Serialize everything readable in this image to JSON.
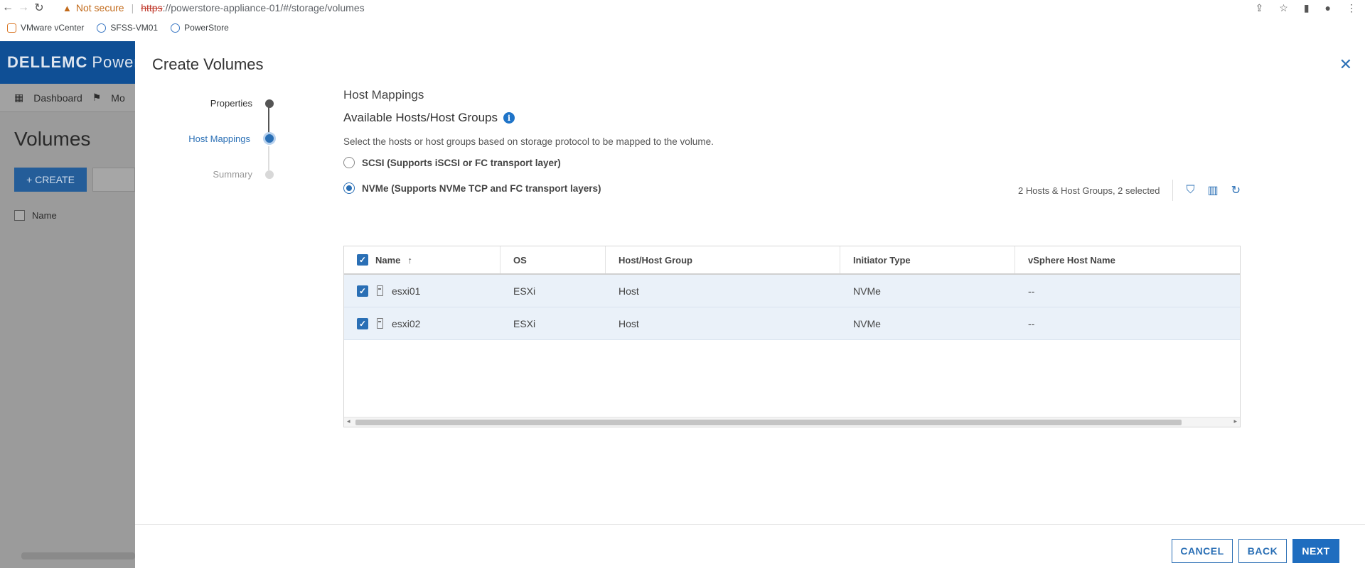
{
  "browser": {
    "warning_text": "Not secure",
    "url_scheme": "https",
    "url_rest": "://powerstore-appliance-01/#/storage/volumes",
    "bookmarks": [
      "VMware vCenter",
      "SFSS-VM01",
      "PowerStore"
    ]
  },
  "background_app": {
    "brand": "DELLEMC",
    "product": "Power",
    "nav_items": [
      "Dashboard",
      "Mo"
    ],
    "page_title": "Volumes",
    "create_label": "+ CREATE",
    "column_name": "Name"
  },
  "dialog": {
    "title": "Create Volumes",
    "steps": [
      {
        "label": "Properties",
        "state": "completed"
      },
      {
        "label": "Host Mappings",
        "state": "current"
      },
      {
        "label": "Summary",
        "state": "pending"
      }
    ],
    "section_title": "Host Mappings",
    "subtitle": "Available Hosts/Host Groups",
    "description": "Select the hosts or host groups based on storage protocol to be mapped to the volume.",
    "protocols": [
      {
        "label": "SCSI (Supports iSCSI or FC transport layer)",
        "selected": false
      },
      {
        "label": "NVMe (Supports NVMe TCP and FC transport layers)",
        "selected": true
      }
    ],
    "table_summary": "2 Hosts & Host Groups, 2 selected",
    "columns": [
      "Name",
      "OS",
      "Host/Host Group",
      "Initiator Type",
      "vSphere Host Name"
    ],
    "rows": [
      {
        "name": "esxi01",
        "os": "ESXi",
        "type": "Host",
        "initiator": "NVMe",
        "vsphere": "--",
        "checked": true
      },
      {
        "name": "esxi02",
        "os": "ESXi",
        "type": "Host",
        "initiator": "NVMe",
        "vsphere": "--",
        "checked": true
      }
    ],
    "buttons": {
      "cancel": "CANCEL",
      "back": "BACK",
      "next": "NEXT"
    }
  },
  "colors": {
    "accent": "#2a6fb5",
    "header_bg": "#0f4f95"
  }
}
